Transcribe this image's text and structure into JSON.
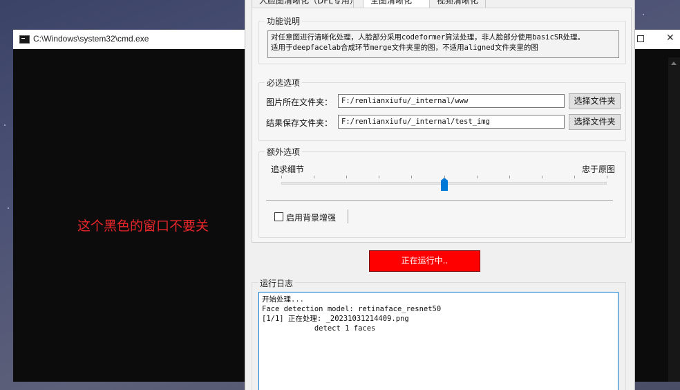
{
  "cmd_window": {
    "title": "C:\\Windows\\system32\\cmd.exe",
    "note": "这个黑色的窗口不要关",
    "note_color": "#e8262a"
  },
  "app": {
    "tabs": [
      {
        "label": "人脸图清晰化（DFL专用）",
        "active": false
      },
      {
        "label": "全图清晰化",
        "active": true
      },
      {
        "label": "视频清晰化",
        "active": false
      }
    ],
    "description": {
      "title": "功能说明",
      "text_line1": "对任意图进行清晰化处理，人脸部分采用codeformer算法处理，非人脸部分使用basicSR处理。",
      "text_line2": "适用于deepfacelab合成环节merge文件夹里的图，不适用aligned文件夹里的图"
    },
    "required": {
      "title": "必选选项",
      "input_label": "图片所在文件夹：",
      "input_value": "F:/renlianxiufu/_internal/www",
      "output_label": "结果保存文件夹：",
      "output_value": "F:/renlianxiufu/_internal/test_img",
      "browse_label": "选择文件夹"
    },
    "extra": {
      "title": "额外选项",
      "slider_left_label": "追求细节",
      "slider_right_label": "忠于原图",
      "slider_value_fraction": 0.5,
      "slider_ticks": 11,
      "bg_enhance_label": "启用背景增强",
      "bg_enhance_checked": false
    },
    "run_button": {
      "label": "正在运行中..",
      "color": "#ff0000"
    },
    "log": {
      "title": "运行日志",
      "lines": [
        "开始处理...",
        "Face detection model: retinaface_resnet50",
        "[1/1] 正在处理: _20231031214409.png",
        "            detect 1 faces"
      ]
    }
  }
}
